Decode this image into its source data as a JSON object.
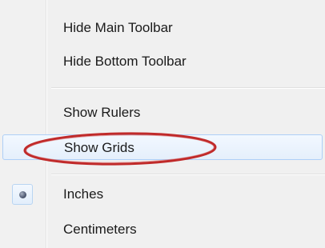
{
  "menu": {
    "items": [
      {
        "label": "Hide Main Toolbar"
      },
      {
        "label": "Hide Bottom Toolbar"
      },
      {
        "label": "Show Rulers"
      },
      {
        "label": "Show Grids"
      },
      {
        "label": "Inches",
        "selected": true
      },
      {
        "label": "Centimeters"
      }
    ],
    "hovered_item": "Show Grids"
  },
  "annotation": {
    "type": "ellipse-highlight",
    "color": "#c02a2a"
  },
  "colors": {
    "menu_background": "#f0f0f0",
    "hover_border": "#aecff7",
    "highlight_ellipse": "#c02a2a"
  }
}
